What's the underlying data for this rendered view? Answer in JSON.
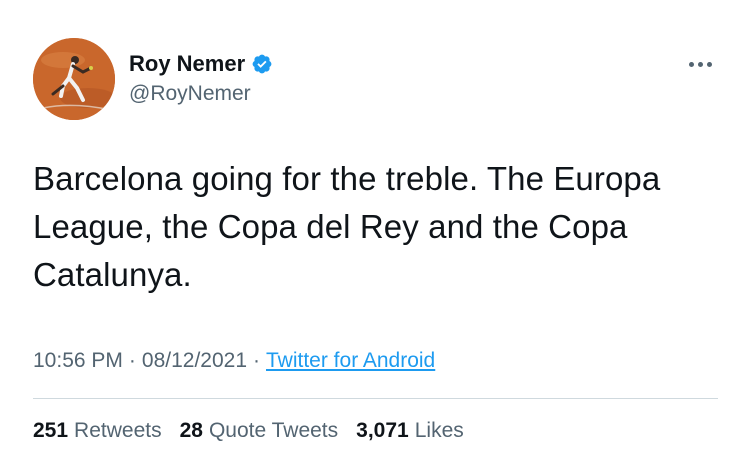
{
  "author": {
    "display_name": "Roy Nemer",
    "handle": "@RoyNemer",
    "verified": true
  },
  "tweet": {
    "text": "Barcelona going for the treble. The Europa League, the Copa del Rey and the Copa Catalunya.",
    "time": "10:56 PM",
    "date": "08/12/2021",
    "source": "Twitter for Android",
    "separator": "·"
  },
  "stats": {
    "retweets": {
      "count": "251",
      "label": "Retweets"
    },
    "quote_tweets": {
      "count": "28",
      "label": "Quote Tweets"
    },
    "likes": {
      "count": "3,071",
      "label": "Likes"
    }
  },
  "colors": {
    "text_primary": "#0f1419",
    "text_secondary": "#536471",
    "link": "#1d9bf0",
    "verified": "#1d9bf0",
    "divider": "#cfd9de"
  },
  "icons": {
    "verified": "verified-badge-icon",
    "more": "more-options-icon"
  }
}
